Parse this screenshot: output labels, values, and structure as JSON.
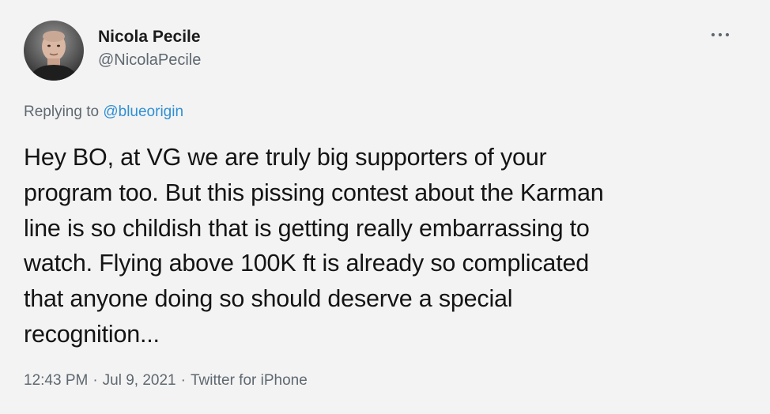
{
  "author": {
    "display_name": "Nicola Pecile",
    "handle": "@NicolaPecile"
  },
  "reply": {
    "prefix": "Replying to",
    "mention": "@blueorigin"
  },
  "tweet": {
    "lines": [
      "Hey BO, at VG we are truly big supporters of your",
      "program too. But this pissing contest about the Karman",
      "line is so childish that is getting really embarrassing to",
      "watch. Flying above 100K ft is already so complicated",
      "that anyone doing so should deserve a special",
      "recognition..."
    ]
  },
  "meta": {
    "time": "12:43 PM",
    "date": "Jul 9, 2021",
    "separator": "·",
    "source": "Twitter for iPhone"
  },
  "icons": {
    "more": "more-options-icon",
    "avatar": "avatar"
  },
  "colors": {
    "background": "#f3f3f3",
    "text": "#141414",
    "secondary": "#5f6870",
    "link": "#2f8fd4"
  }
}
